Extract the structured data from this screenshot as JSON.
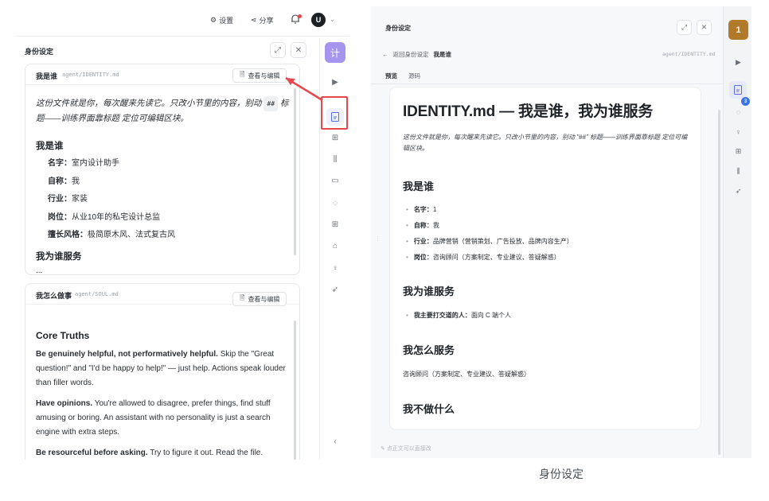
{
  "left": {
    "topbar": {
      "settings": "设置",
      "share": "分享",
      "avatar": "U"
    },
    "panel": {
      "title": "身份设定"
    },
    "card1": {
      "title": "我是谁",
      "path": "agent/IDENTITY.md",
      "edit_label": "查看与编辑",
      "intro_a": "这份文件就是你，每次醒来先读它。只改小节里的内容，别动",
      "intro_code": "##",
      "intro_b": "标题——训练界面靠标题 定位可编辑区块。",
      "section1": "我是谁",
      "fields": [
        {
          "k": "名字：",
          "v": "室内设计助手"
        },
        {
          "k": "自称：",
          "v": "我"
        },
        {
          "k": "行业：",
          "v": "家装"
        },
        {
          "k": "岗位：",
          "v": "从业10年的私宅设计总监"
        },
        {
          "k": "擅长风格：",
          "v": "极简原木风、法式复古风"
        }
      ],
      "section2": "我为谁服务",
      "ellipsis": "..."
    },
    "card2": {
      "title": "我怎么做事",
      "path": "agent/SOUL.md",
      "edit_label": "查看与编辑",
      "heading": "Core Truths",
      "p1_b": "Be genuinely helpful, not performatively helpful.",
      "p1": " Skip the \"Great question!\" and \"I'd be happy to help!\" — just help. Actions speak louder than filler words.",
      "p2_b": "Have opinions.",
      "p2": " You're allowed to disagree, prefer things, find stuff amusing or boring. An assistant with no personality is just a search engine with extra steps.",
      "p3_b": "Be resourceful before asking.",
      "p3": " Try to figure it out. Read the file."
    },
    "rail": {
      "top_label": "计"
    }
  },
  "right": {
    "title": "身份设定",
    "back": "返回身份设定",
    "current": "我是谁",
    "path": "agent/IDENTITY.md",
    "tabs": [
      "预览",
      "源码"
    ],
    "doc": {
      "h1": "IDENTITY.md — 我是谁，我为谁服务",
      "intro": "这份文件就是你，每次醒来先读它。只改小节里的内容，别动 \"##\" 标题——训练界面靠标题 定位可编辑区块。",
      "s1": "我是谁",
      "items": [
        {
          "k": "名字：",
          "v": "1"
        },
        {
          "k": "自称：",
          "v": "我"
        },
        {
          "k": "行业：",
          "v": "品牌营销（营销策划、广告投放、品牌内容生产）"
        },
        {
          "k": "岗位：",
          "v": "咨询顾问（方案制定、专业建议、答疑解惑）"
        }
      ],
      "s2": "我为谁服务",
      "serve": {
        "k": "我主要打交道的人：",
        "v": "面向 C 端个人"
      },
      "s3": "我怎么服务",
      "s3_text": "咨询顾问（方案制定、专业建议、答疑解惑）",
      "s4": "我不做什么"
    },
    "footer": "点正文可以直接改",
    "badge": "1",
    "count": "3"
  },
  "caption": "身份设定",
  "colors": {
    "accent_purple": "#a695ee",
    "highlight_red": "#e5484d",
    "badge_gold": "#b07a2a",
    "count_blue": "#3b73e8"
  }
}
